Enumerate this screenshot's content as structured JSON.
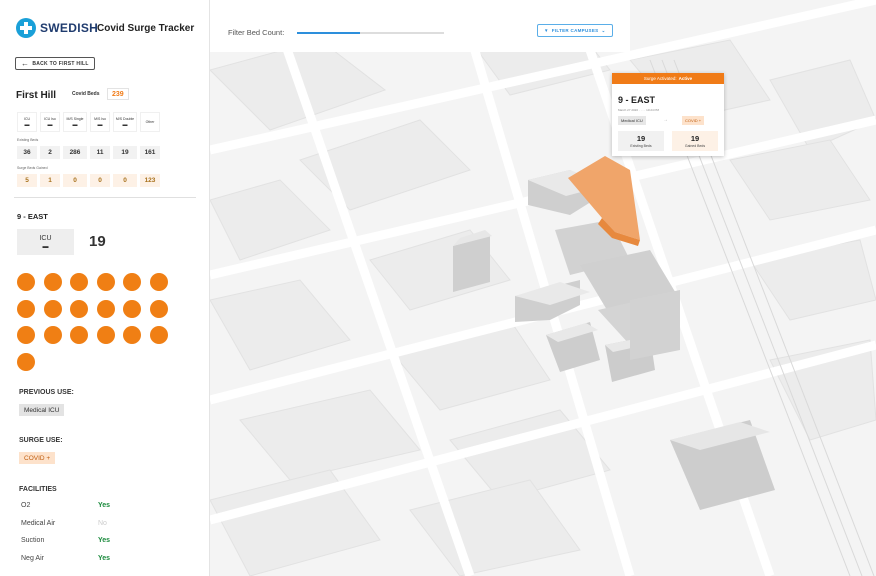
{
  "brand": {
    "name": "SWEDISH",
    "app_title": "Covid Surge Tracker"
  },
  "back_button": {
    "label": "BACK TO FIRST HILL"
  },
  "campus": {
    "name": "First Hill",
    "covid_beds_label": "Covid Beds",
    "covid_beds_value": "239",
    "bed_types": [
      "ICU",
      "ICU Iso",
      "M/S Single",
      "M/S Iso",
      "M/S Double",
      "Other"
    ],
    "existing_label": "Existing Beds",
    "existing_values": [
      "36",
      "2",
      "286",
      "11",
      "19",
      "161"
    ],
    "surge_label": "Surge Beds Gained",
    "surge_values": [
      "5",
      "1",
      "0",
      "0",
      "0",
      "123"
    ]
  },
  "unit": {
    "name": "9 - EAST",
    "type": "ICU",
    "count": "19",
    "dot_count": 19
  },
  "previous_use": {
    "heading": "PREVIOUS USE:",
    "value": "Medical ICU"
  },
  "surge_use": {
    "heading": "SURGE USE:",
    "value": "COVID +"
  },
  "facilities": {
    "heading": "FACILITIES",
    "items": [
      {
        "name": "O2",
        "value": "Yes"
      },
      {
        "name": "Medical Air",
        "value": "No"
      },
      {
        "name": "Suction",
        "value": "Yes"
      },
      {
        "name": "Neg Air",
        "value": "Yes"
      }
    ]
  },
  "topbar": {
    "filter_label": "Filter Bed Count:",
    "filter_campuses_label": "FILTER CAMPUSES",
    "slider_fill_fraction": 0.43
  },
  "popup": {
    "status_label": "Surge Activated:",
    "status_value": "Active",
    "title": "9 - EAST",
    "date": "March 27 2020 · · · · 10:24 PM",
    "from": "Medical ICU",
    "to": "COVID +",
    "existing_num": "19",
    "existing_label": "Existing Beds",
    "gained_num": "19",
    "gained_label": "Gained Beds"
  },
  "colors": {
    "accent_orange": "#f07b17",
    "brand_blue": "#1f3b6e",
    "link_blue": "#2d8fdc",
    "yes_green": "#1a8a3c"
  },
  "icons": {
    "logo": "swedish-cross-logo",
    "back": "arrow-left-icon",
    "bed": "bed-icon",
    "filter": "filter-icon"
  }
}
